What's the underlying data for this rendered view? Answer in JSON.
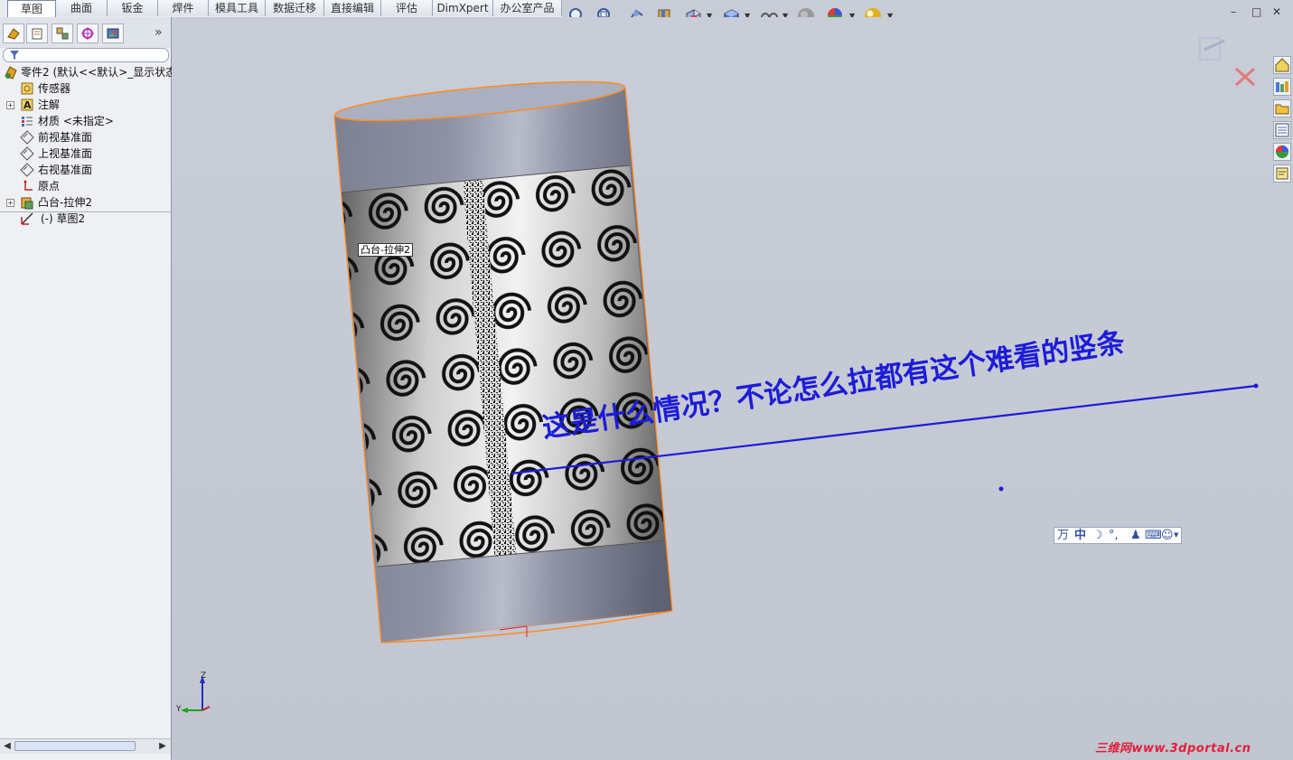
{
  "tabs": [
    "草图",
    "曲面",
    "钣金",
    "焊件",
    "模具工具",
    "数据迁移",
    "直接编辑",
    "评估",
    "DimXpert",
    "办公室产品"
  ],
  "active_tab": "草图",
  "toolbar": {
    "icons": [
      "zoom-to-fit-icon",
      "zoom-to-area-icon",
      "previous-view-icon",
      "section-view-icon",
      "view-orientation-icon",
      "display-style-icon",
      "hide-show-items-icon",
      "edit-appearance-icon",
      "apply-scene-icon",
      "view-settings-icon"
    ]
  },
  "window_controls": {
    "minimize": "–",
    "restore": "□",
    "close": "✕"
  },
  "panel": {
    "tabs": [
      "feature-manager-icon",
      "property-manager-icon",
      "configuration-manager-icon",
      "dimxpert-manager-icon",
      "display-manager-icon"
    ],
    "more": "»",
    "tree": [
      {
        "label": "零件2  (默认<<默认>_显示状态",
        "icon": "part-icon",
        "expandable": false
      },
      {
        "label": "传感器",
        "icon": "sensor-icon",
        "expandable": false
      },
      {
        "label": "注解",
        "icon": "annotation-icon",
        "expandable": true
      },
      {
        "label": "材质 <未指定>",
        "icon": "material-icon",
        "expandable": false
      },
      {
        "label": "前视基准面",
        "icon": "plane-icon",
        "expandable": false
      },
      {
        "label": "上视基准面",
        "icon": "plane-icon",
        "expandable": false
      },
      {
        "label": "右视基准面",
        "icon": "plane-icon",
        "expandable": false
      },
      {
        "label": "原点",
        "icon": "origin-icon",
        "expandable": false
      },
      {
        "label": "凸台-拉伸2",
        "icon": "extrude-icon",
        "expandable": true
      },
      {
        "label": "(-) 草图2",
        "icon": "sketch-icon",
        "expandable": false
      }
    ]
  },
  "viewport": {
    "tooltip": "凸台-拉伸2",
    "annotation": "这是什么情况？不论怎么拉都有这个难看的竖条",
    "annotation_color": "#1c1cd8",
    "ime_bar": {
      "items": [
        "万",
        "中",
        "☽",
        "°,",
        "⌨",
        "☺"
      ]
    },
    "triad": {
      "z": "Z",
      "y": "Y"
    },
    "watermark": "三维网www.3dportal.cn"
  },
  "colors": {
    "edge_highlight": "#ff8a1f",
    "viewport_bg": "#c6cad5"
  }
}
